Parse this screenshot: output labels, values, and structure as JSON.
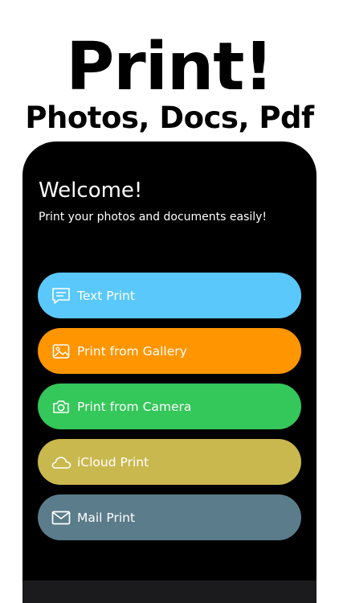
{
  "promo": {
    "headline": "Print!",
    "subheadline": "Photos, Docs, Pdf"
  },
  "welcome": {
    "title": "Welcome!",
    "subtitle": "Print your photos and documents easily!"
  },
  "menu": {
    "items": [
      {
        "label": "Text Print",
        "icon": "chat-bubble-icon",
        "color": "#5ac8fa"
      },
      {
        "label": "Print from Gallery",
        "icon": "photo-icon",
        "color": "#ff9500"
      },
      {
        "label": "Print from Camera",
        "icon": "camera-icon",
        "color": "#34c759"
      },
      {
        "label": "iCloud Print",
        "icon": "cloud-icon",
        "color": "#c9b84e"
      },
      {
        "label": "Mail Print",
        "icon": "envelope-icon",
        "color": "#5b7c8a"
      }
    ]
  },
  "tabbar": {
    "items": [
      {
        "icon": "home-tab-icon",
        "color": "#0a84ff"
      },
      {
        "icon": "settings-tab-icon",
        "color": "#8e8e93"
      }
    ]
  }
}
